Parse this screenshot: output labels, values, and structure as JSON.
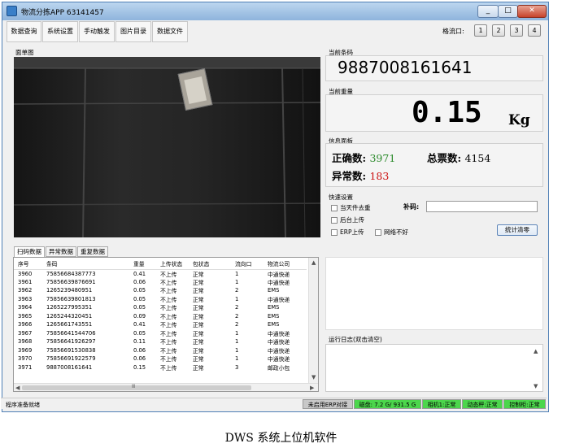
{
  "window": {
    "title": "物流分拣APP  63141457",
    "min_icon": "minimize-icon",
    "max_icon": "maximize-icon",
    "close_symbol": "✕"
  },
  "menu": [
    "数据查询",
    "系统设置",
    "手动触发",
    "图片目录",
    "数据文件"
  ],
  "flow": {
    "label": "格流口:",
    "buttons": [
      "1",
      "2",
      "3",
      "4"
    ]
  },
  "camera": {
    "label": "面单图"
  },
  "barcode": {
    "label": "当前条码",
    "value": "9887008161641"
  },
  "weight": {
    "label": "当前重量",
    "value": "0.15",
    "unit": "Kg"
  },
  "info": {
    "label": "信息面板",
    "correct_label": "正确数:",
    "correct_value": "3971",
    "total_label": "总票数:",
    "total_value": "4154",
    "error_label": "异常数:",
    "error_value": "183"
  },
  "quick": {
    "label": "快速设置",
    "options": [
      "当天件去重",
      "后台上传",
      "ERP上传",
      "网络不好"
    ],
    "fill_label": "补码:",
    "stats_clear": "统计清零"
  },
  "tabs": [
    "扫码数据",
    "异常数据",
    "重复数据"
  ],
  "table": {
    "headers": [
      "序号",
      "条码",
      "重量",
      "上传状态",
      "包状态",
      "流向口",
      "物流公司"
    ],
    "rows": [
      [
        "3960",
        "75856684387773",
        "0.41",
        "不上传",
        "正常",
        "1",
        "中通快递"
      ],
      [
        "3961",
        "75856639876691",
        "0.06",
        "不上传",
        "正常",
        "1",
        "中通快递"
      ],
      [
        "3962",
        "1265239480951",
        "0.05",
        "不上传",
        "正常",
        "2",
        "EMS"
      ],
      [
        "3963",
        "75856639801813",
        "0.05",
        "不上传",
        "正常",
        "1",
        "中通快递"
      ],
      [
        "3964",
        "1265227995351",
        "0.05",
        "不上传",
        "正常",
        "2",
        "EMS"
      ],
      [
        "3965",
        "1265244320451",
        "0.09",
        "不上传",
        "正常",
        "2",
        "EMS"
      ],
      [
        "3966",
        "1265661743551",
        "0.41",
        "不上传",
        "正常",
        "2",
        "EMS"
      ],
      [
        "3967",
        "75856641544706",
        "0.05",
        "不上传",
        "正常",
        "1",
        "中通快递"
      ],
      [
        "3968",
        "75856641926297",
        "0.11",
        "不上传",
        "正常",
        "1",
        "中通快递"
      ],
      [
        "3969",
        "75856691530838",
        "0.06",
        "不上传",
        "正常",
        "1",
        "中通快递"
      ],
      [
        "3970",
        "75856691922579",
        "0.06",
        "不上传",
        "正常",
        "1",
        "中通快递"
      ],
      [
        "3971",
        "9887008161641",
        "0.15",
        "不上传",
        "正常",
        "3",
        "邮政小包"
      ]
    ]
  },
  "scroll": {
    "up": "▲",
    "down": "▼",
    "left": "◀",
    "right": "▶",
    "grip": "Ⅲ"
  },
  "log": {
    "label": "运行日志(双击清空)"
  },
  "status": {
    "text": "程序准备就绪",
    "segments": [
      "未启用ERP对接",
      "磁盘: 7.2 G/ 931.5 G",
      "相机1:正常",
      "动态秤:正常",
      "控制柜:正常"
    ]
  },
  "caption": "DWS 系统上位机软件"
}
